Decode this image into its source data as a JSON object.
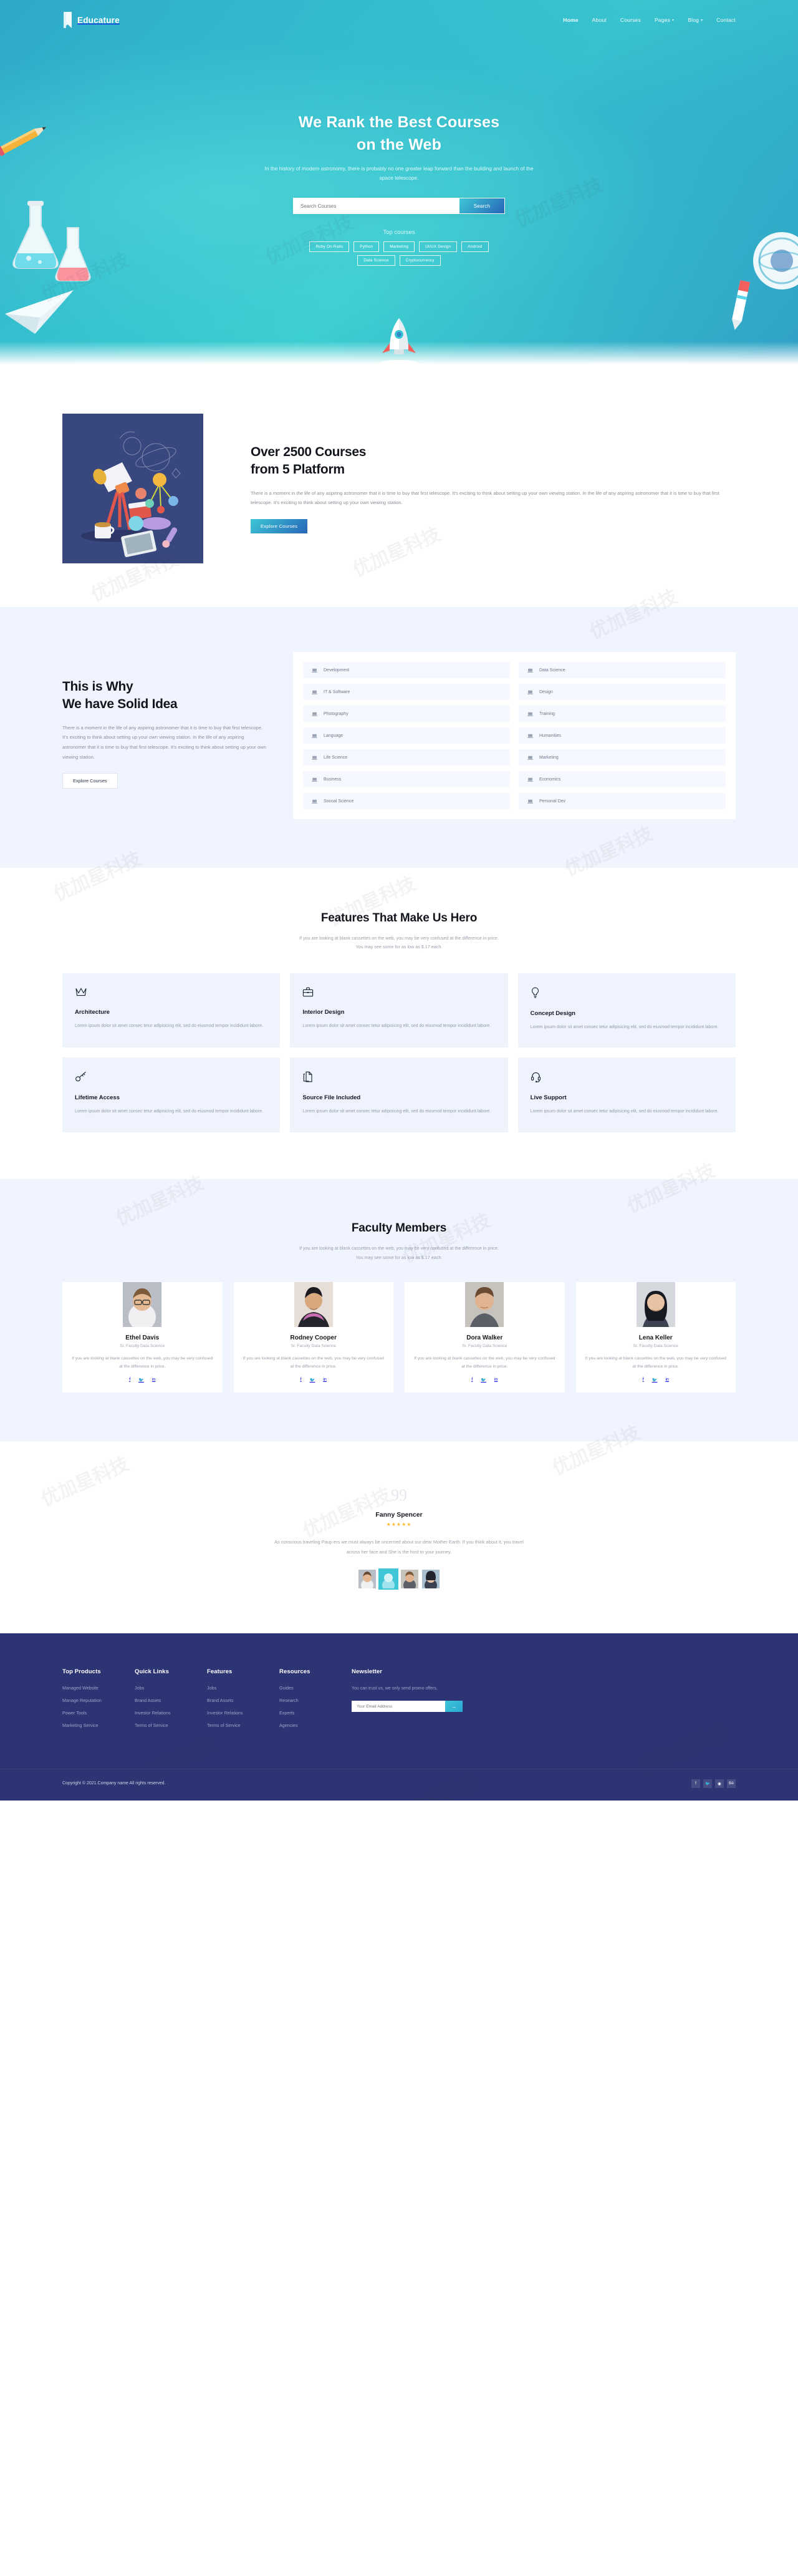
{
  "nav": {
    "brand": "Educature",
    "items": [
      {
        "label": "Home",
        "caret": false,
        "active": true
      },
      {
        "label": "About",
        "caret": false,
        "active": false
      },
      {
        "label": "Courses",
        "caret": false,
        "active": false
      },
      {
        "label": "Pages",
        "caret": true,
        "active": false
      },
      {
        "label": "Blog",
        "caret": true,
        "active": false
      },
      {
        "label": "Contact",
        "caret": false,
        "active": false
      }
    ]
  },
  "hero": {
    "title_line1": "We Rank the Best Courses",
    "title_line2": "on the Web",
    "subtitle": "In the history of modern astronomy, there is probably no one greater leap forward than the building and launch of the space telescope.",
    "search_placeholder": "Search Courses",
    "search_value": "",
    "search_button": "Search",
    "top_courses_label": "Top courses",
    "tags": [
      "Ruby On Rails",
      "Python",
      "Marketing",
      "UI/UX Design",
      "Android",
      "Data Science",
      "Cryptocurrency"
    ]
  },
  "courses": {
    "title_line1": "Over 2500 Courses",
    "title_line2": "from 5 Platform",
    "body": "There is a moment in the life of any aspiring astronomer that it is time to buy that first telescope. It's exciting to think about setting up your own viewing station. In the life of any aspiring astronomer that it is time to buy that first telescope. It's exciting to think about setting up your own viewing station.",
    "button": "Explore Courses"
  },
  "why": {
    "title_line1": "This is Why",
    "title_line2": "We have Solid Idea",
    "body": "There is a moment in the life of any aspiring astronomer that it is time to buy that first telescope. It's exciting to think about setting up your own viewing station. In the life of any aspiring astronomer that it is time to buy that first telescope. It's exciting to think about setting up your own viewing station.",
    "button": "Explore Courses",
    "categories_left": [
      "Development",
      "IT & Software",
      "Photography",
      "Language",
      "Life Science",
      "Business",
      "Socoal Science"
    ],
    "categories_right": [
      "Data Science",
      "Design",
      "Training",
      "Humanities",
      "Marketing",
      "Economics",
      "Personal Dev"
    ]
  },
  "features": {
    "title": "Features That Make Us Hero",
    "sub_line1": "If you are looking at blank cassettes on the web, you may be very confused at the difference in price.",
    "sub_line2": "You may see some for as low as $.17 each.",
    "cards": [
      {
        "icon": "crown-icon",
        "title": "Architecture",
        "text": "Lorem ipsum dolor sit amet consec tetur adipisicing elit, sed do eiusmod tempor incididunt labore."
      },
      {
        "icon": "briefcase-icon",
        "title": "Interior Design",
        "text": "Lorem ipsum dolor sit amet consec tetur adipisicing elit, sed do eiusmod tempor incididunt labore."
      },
      {
        "icon": "lightbulb-icon",
        "title": "Concept Design",
        "text": "Lorem ipsum dolor sit amet consec tetur adipisicing elit, sed do eiusmod tempor incididunt labore."
      },
      {
        "icon": "key-icon",
        "title": "Lifetime Access",
        "text": "Lorem ipsum dolor sit amet consec tetur adipisicing elit, sed do eiusmod tempor incididunt labore."
      },
      {
        "icon": "files-icon",
        "title": "Source File Included",
        "text": "Lorem ipsum dolor sit amet consec tetur adipisicing elit, sed do eiusmod tempor incididunt labore."
      },
      {
        "icon": "headset-icon",
        "title": "Live Support",
        "text": "Lorem ipsum dolor sit amet consec tetur adipisicing elit, sed do eiusmod tempor incididunt labore."
      }
    ]
  },
  "faculty": {
    "title": "Faculty Members",
    "sub_line1": "If you are looking at blank cassettes on the web, you may be very confused at the difference in price.",
    "sub_line2": "You may see some for as low as $.17 each.",
    "members": [
      {
        "name": "Ethel Davis",
        "role": "Sr. Faculty Data Science",
        "text": "If you are looking at blank cassettes on the web, you may be very confused at the difference in price."
      },
      {
        "name": "Rodney Cooper",
        "role": "Sr. Faculty Data Science",
        "text": "If you are looking at blank cassettes on the web, you may be very confused at the difference in price."
      },
      {
        "name": "Dora Walker",
        "role": "Sr. Faculty Data Science",
        "text": "If you are looking at blank cassettes on the web, you may be very confused at the difference in price."
      },
      {
        "name": "Lena Keller",
        "role": "Sr. Faculty Data Science",
        "text": "If you are looking at blank cassettes on the web, you may be very confused at the difference in price."
      }
    ],
    "social": [
      "f",
      "t",
      "in"
    ]
  },
  "testimonial": {
    "quote_mark": "99",
    "name": "Fanny Spencer",
    "stars": "★★★★★",
    "text": "As conscious traveling Paup ers we must always be oncerned about our dear Mother Earth. If you think about it, you travel across her face and She is the host to your journey."
  },
  "footer": {
    "columns": [
      {
        "heading": "Top Products",
        "links": [
          "Managed Website",
          "Manage Reputation",
          "Power Tools",
          "Marketing Service"
        ]
      },
      {
        "heading": "Quick Links",
        "links": [
          "Jobs",
          "Brand Assets",
          "Investor Relations",
          "Terms of Service"
        ]
      },
      {
        "heading": "Features",
        "links": [
          "Jobs",
          "Brand Assets",
          "Investor Relations",
          "Terms of Service"
        ]
      },
      {
        "heading": "Resources",
        "links": [
          "Guides",
          "Research",
          "Experts",
          "Agencies"
        ]
      }
    ],
    "newsletter": {
      "heading": "Newsletter",
      "note": "You can trust us, we only send promo offers,",
      "placeholder": "Your Email Address",
      "value": "",
      "button": "→"
    },
    "copyright": "Copyright © 2021.Company name All rights reserved.",
    "social": [
      "f",
      "t",
      "d",
      "Bē"
    ]
  },
  "colors": {
    "hero_start": "#2fa7c9",
    "hero_end": "#3ccfd0",
    "accent_blue": "#2766b8",
    "accent_cyan": "#3ec6d6",
    "footer_bg": "#2d3473",
    "light_bg": "#eff4fe",
    "star": "#f8b92c"
  }
}
